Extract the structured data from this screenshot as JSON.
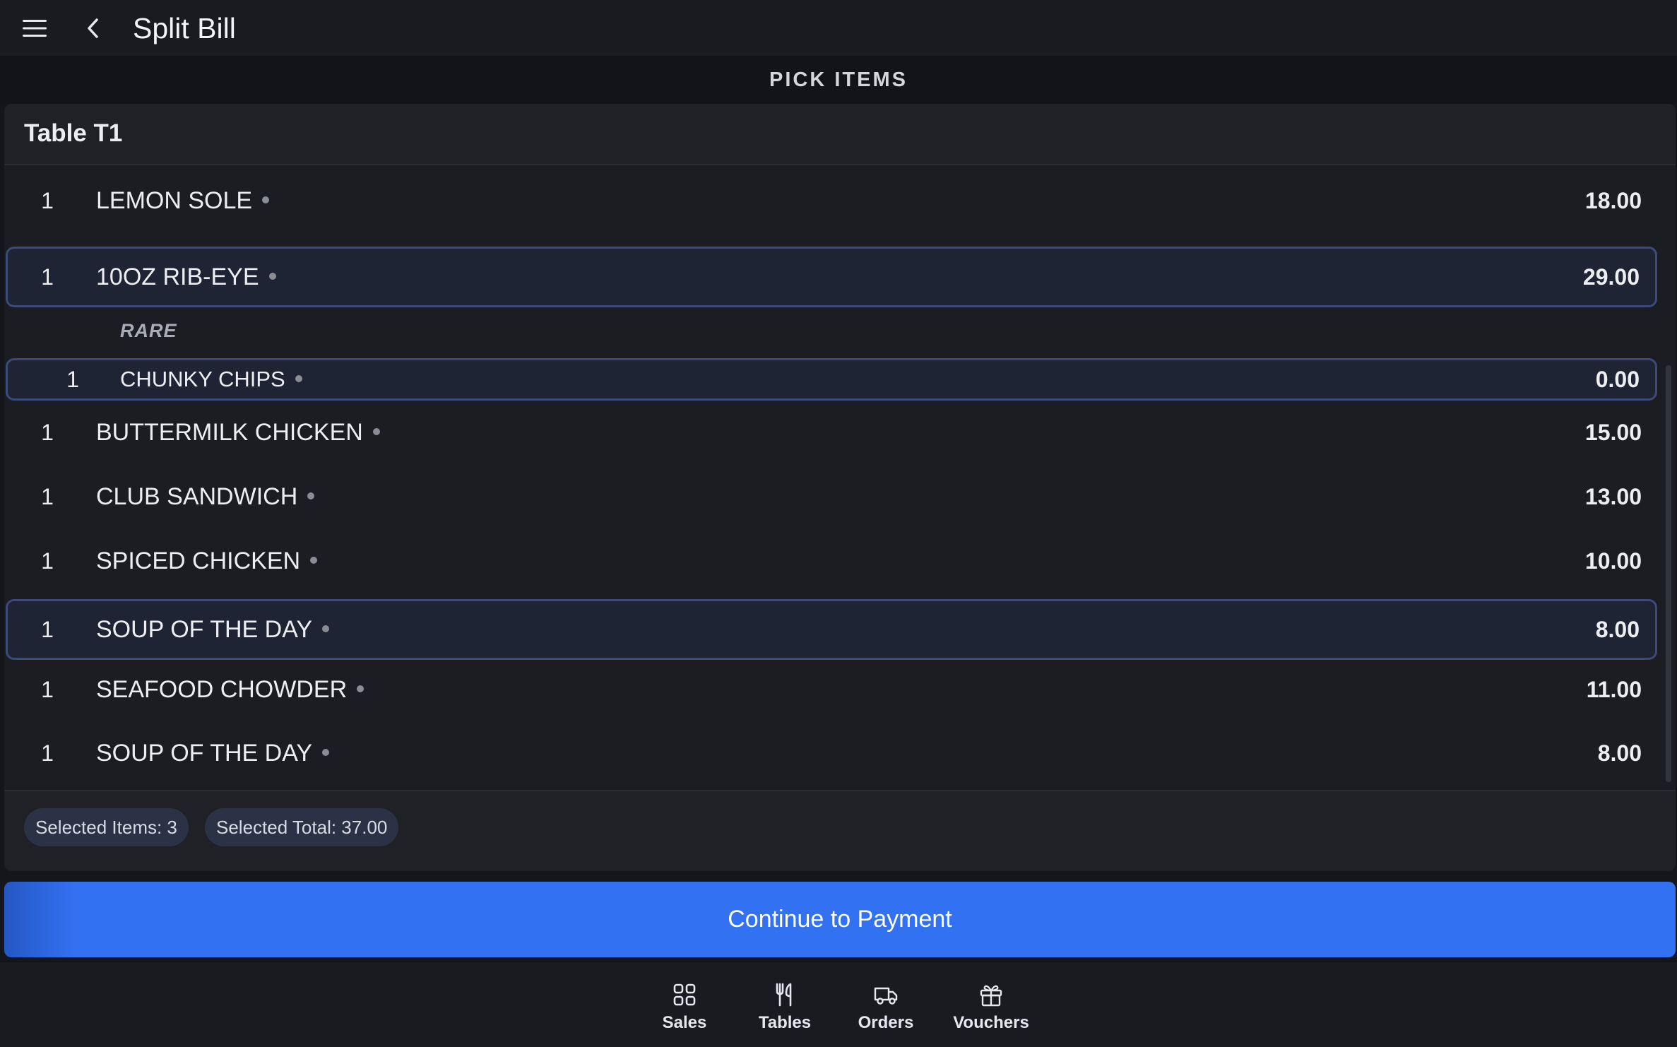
{
  "header": {
    "title": "Split Bill",
    "menu_icon": "hamburger-menu-icon",
    "back_icon": "chevron-left-icon"
  },
  "section_title": "PICK ITEMS",
  "table": {
    "name": "Table T1"
  },
  "items": [
    {
      "qty": "1",
      "name": "LEMON SOLE",
      "price": "18.00",
      "selected": false
    },
    {
      "qty": "1",
      "name": "10OZ RIB-EYE",
      "price": "29.00",
      "selected": true
    },
    {
      "modifier": "RARE"
    },
    {
      "qty": "1",
      "name": "CHUNKY CHIPS",
      "price": "0.00",
      "selected": true,
      "sub_item": true
    },
    {
      "qty": "1",
      "name": "BUTTERMILK CHICKEN",
      "price": "15.00",
      "selected": false
    },
    {
      "qty": "1",
      "name": "CLUB SANDWICH",
      "price": "13.00",
      "selected": false
    },
    {
      "qty": "1",
      "name": "SPICED CHICKEN",
      "price": "10.00",
      "selected": false
    },
    {
      "qty": "1",
      "name": "SOUP OF THE DAY",
      "price": "8.00",
      "selected": true
    },
    {
      "qty": "1",
      "name": "SEAFOOD CHOWDER",
      "price": "11.00",
      "selected": false
    },
    {
      "qty": "1",
      "name": "SOUP OF THE DAY",
      "price": "8.00",
      "selected": false
    }
  ],
  "summary": {
    "selected_items": "Selected Items: 3",
    "selected_total": "Selected Total: 37.00"
  },
  "continue_label": "Continue to Payment",
  "colors": {
    "accent": "#3271f2",
    "selected_border": "#3b4a78",
    "background": "#14161c"
  },
  "nav": [
    {
      "label": "Sales",
      "icon": "grid-icon"
    },
    {
      "label": "Tables",
      "icon": "utensils-icon"
    },
    {
      "label": "Orders",
      "icon": "delivery-truck-icon"
    },
    {
      "label": "Vouchers",
      "icon": "gift-icon"
    }
  ]
}
